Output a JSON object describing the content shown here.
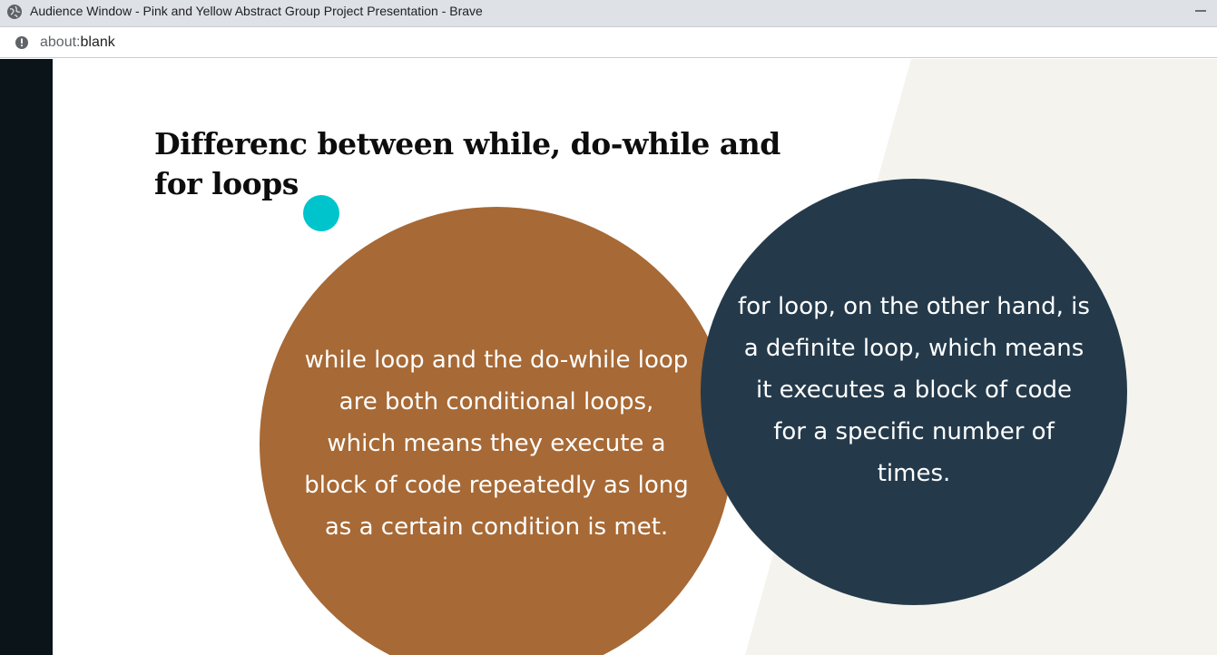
{
  "window": {
    "title": "Audience Window - Pink and Yellow Abstract Group Project Presentation - Brave"
  },
  "address_bar": {
    "url_scheme": "about:",
    "url_rest": "blank"
  },
  "slide": {
    "title_line1": "Differenc  between while, do-while and",
    "title_line2": "for loops",
    "left_circle_text": "while loop and the do-while loop are both conditional loops, which means they execute a block of code repeatedly as long as a certain condition is met.",
    "right_circle_text": "for loop, on the other hand, is a definite loop, which means it executes a block of code for a specific number of times."
  },
  "colors": {
    "left_circle": "#a76935",
    "right_circle": "#243a4b",
    "pointer": "#00c4cc",
    "background_shape": "#f4f3ee",
    "side_strip": "#0b1419"
  }
}
